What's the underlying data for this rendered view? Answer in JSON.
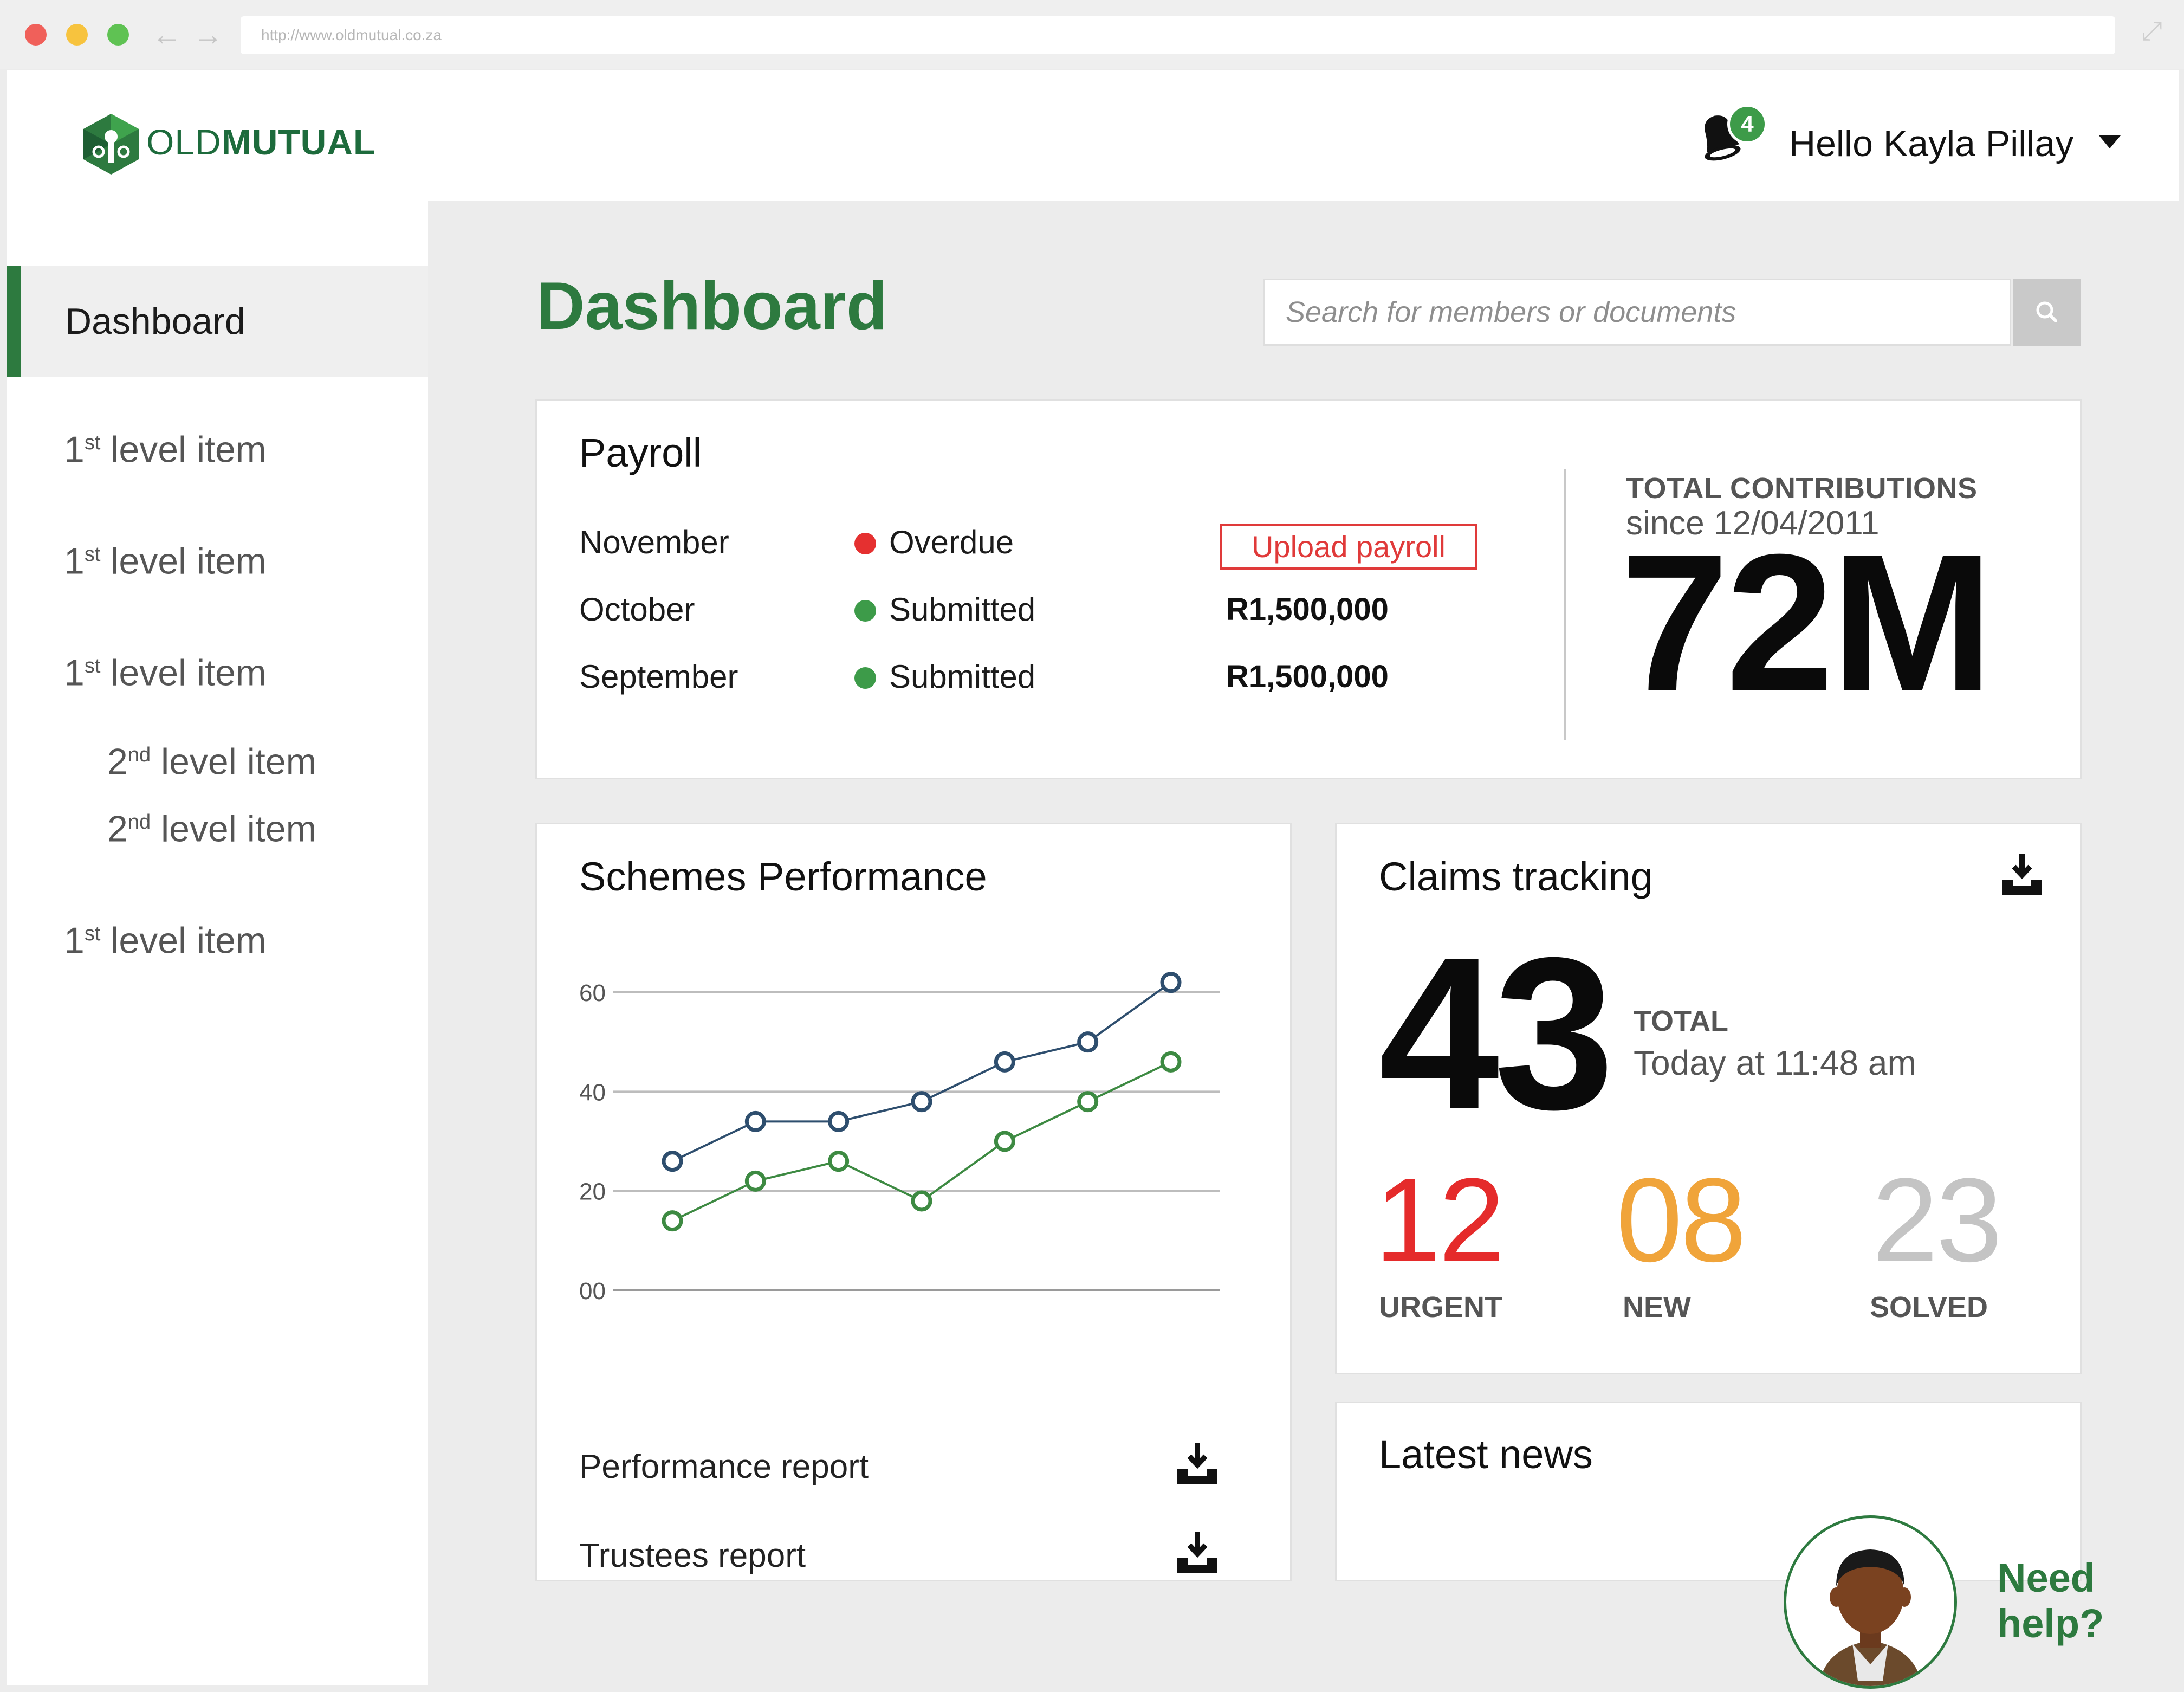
{
  "browser": {
    "url": "http://www.oldmutual.co.za"
  },
  "brand": {
    "name_light": "OLD",
    "name_bold": "MUTUAL",
    "green": "#2d7a3f"
  },
  "user": {
    "greeting": "Hello Kayla Pillay",
    "notification_count": "4"
  },
  "sidebar": {
    "items": [
      {
        "label": "Dashboard",
        "active": true,
        "level": 0
      },
      {
        "num": "1",
        "sup": "st",
        "rest": " level item",
        "level": 1
      },
      {
        "num": "1",
        "sup": "st",
        "rest": " level item",
        "level": 1
      },
      {
        "num": "1",
        "sup": "st",
        "rest": " level item",
        "level": 1
      },
      {
        "num": "2",
        "sup": "nd",
        "rest": " level item",
        "level": 2
      },
      {
        "num": "2",
        "sup": "nd",
        "rest": " level item",
        "level": 2
      },
      {
        "num": "1",
        "sup": "st",
        "rest": " level item",
        "level": 1
      }
    ]
  },
  "main": {
    "title": "Dashboard",
    "search_placeholder": "Search for members or documents"
  },
  "payroll": {
    "title": "Payroll",
    "rows": [
      {
        "month": "November",
        "status": "Overdue",
        "status_color": "#e53030",
        "action": "Upload payroll"
      },
      {
        "month": "October",
        "status": "Submitted",
        "status_color": "#3d9b49",
        "amount": "R1,500,000"
      },
      {
        "month": "September",
        "status": "Submitted",
        "status_color": "#3d9b49",
        "amount": "R1,500,000"
      }
    ],
    "total_label": "TOTAL CONTRIBUTIONS",
    "total_since": "since 12/04/2011",
    "total_value": "72M"
  },
  "schemes": {
    "title": "Schemes Performance",
    "reports": [
      "Performance report",
      "Trustees report"
    ]
  },
  "chart_data": {
    "type": "line",
    "x": [
      1,
      2,
      3,
      4,
      5,
      6,
      7
    ],
    "yticks": [
      "00",
      "20",
      "40",
      "60"
    ],
    "ylim": [
      0,
      60
    ],
    "grid": true,
    "series": [
      {
        "color": "#2e4e6e",
        "values": [
          26,
          34,
          34,
          38,
          46,
          50,
          62
        ]
      },
      {
        "color": "#3d8a42",
        "values": [
          14,
          22,
          26,
          18,
          30,
          38,
          46
        ]
      }
    ]
  },
  "claims": {
    "title": "Claims tracking",
    "total": "43",
    "total_label": "TOTAL",
    "time": "Today at 11:48 am",
    "stats": [
      {
        "value": "12",
        "label": "URGENT",
        "color": "#e52b2b"
      },
      {
        "value": "08",
        "label": "NEW",
        "color": "#f0a43a"
      },
      {
        "value": "23",
        "label": "SOLVED",
        "color": "#c4c4c4"
      }
    ]
  },
  "news": {
    "title": "Latest news"
  },
  "help": {
    "line1": "Need",
    "line2": "help?"
  }
}
